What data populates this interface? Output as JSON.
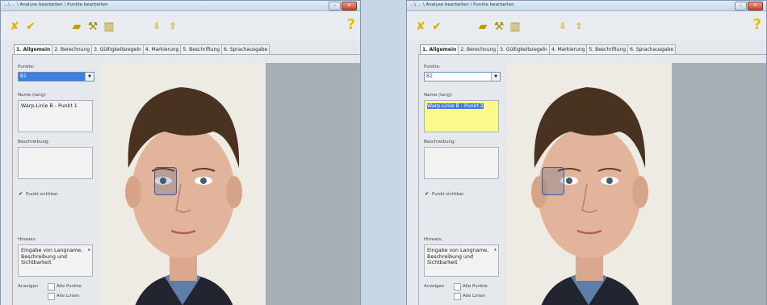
{
  "window_title": "...\\ ... \\ Analyse bearbeiten \\ Punkte bearbeiten",
  "window_controls": {
    "minimize": "–",
    "close": "×"
  },
  "toolbar": {
    "cancel_icon": "close-x-icon",
    "ok_icon": "checkmark-icon",
    "open_icon": "folder-icon",
    "tool_icon": "wrench-icon",
    "delete_icon": "trash-icon",
    "down_icon": "arrow-down-icon",
    "up_icon": "arrow-up-icon",
    "help_icon": "help-question-icon"
  },
  "tabs": [
    "1. Allgemein",
    "2. Berechnung",
    "3. Gültigkeitsregeln",
    "4. Markierung",
    "5. Beschriftung",
    "6. Sprachausgabe"
  ],
  "labels": {
    "punkte": "Punkte:",
    "name": "Name (lang):",
    "beschreibung": "Beschreibung:",
    "punkt_sichtbar": "Punkt sichtbar",
    "hinweis": "Hinweis:",
    "anzeigen": "Anzeigen",
    "alle_punkte": "Alle Punkte",
    "alle_linien": "Alle Linien"
  },
  "hinweis_text": "Eingabe von Langname, Beschreibung und Sichtbarkeit",
  "left": {
    "point_value": "B1",
    "name_value": "Warp-Linie B - Punkt 1",
    "punkt_sichtbar_checked": true
  },
  "right": {
    "point_value": "B2",
    "name_value": "Warp-Linie B - Punkt 2",
    "punkt_sichtbar_checked": true
  },
  "colors": {
    "accent": "#3f7de0",
    "highlight_yellow": "#fafa8c",
    "marker": "#2e5fa8"
  }
}
